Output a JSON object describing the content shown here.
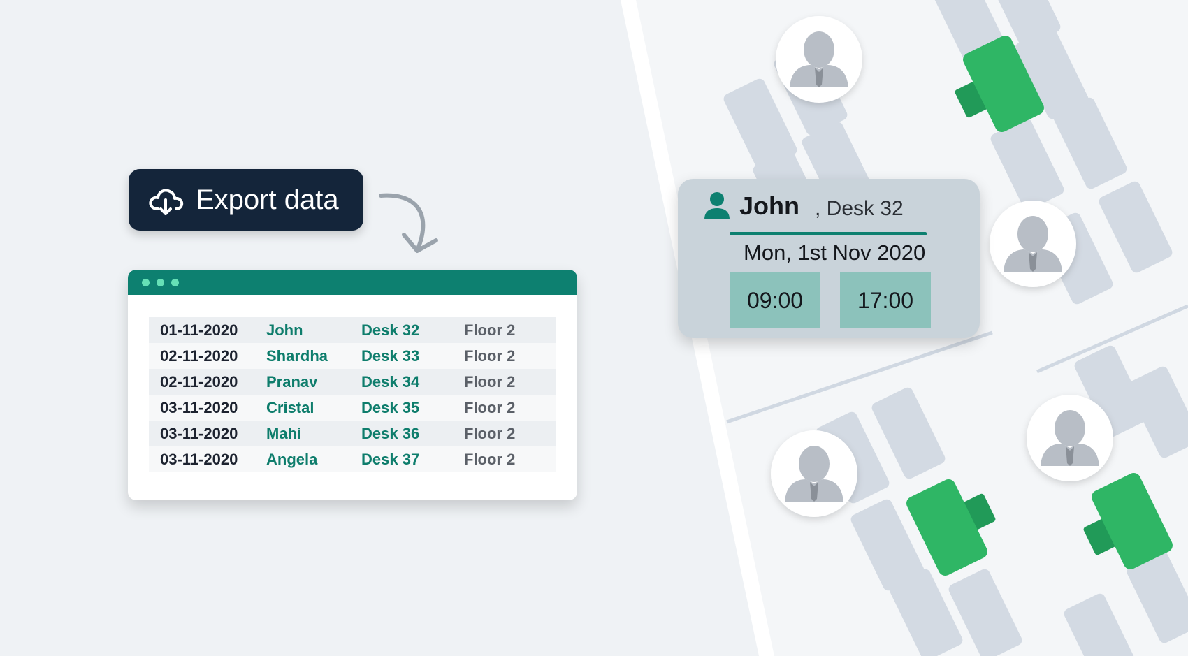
{
  "export_button": {
    "label": "Export data",
    "icon": "cloud-download-icon"
  },
  "sheet": {
    "rows": [
      {
        "date": "01-11-2020",
        "name": "John",
        "desk": "Desk 32",
        "floor": "Floor 2"
      },
      {
        "date": "02-11-2020",
        "name": "Shardha",
        "desk": "Desk 33",
        "floor": "Floor 2"
      },
      {
        "date": "02-11-2020",
        "name": "Pranav",
        "desk": "Desk 34",
        "floor": "Floor 2"
      },
      {
        "date": "03-11-2020",
        "name": "Cristal",
        "desk": "Desk 35",
        "floor": "Floor 2"
      },
      {
        "date": "03-11-2020",
        "name": "Mahi",
        "desk": "Desk 36",
        "floor": "Floor 2"
      },
      {
        "date": "03-11-2020",
        "name": "Angela",
        "desk": "Desk 37",
        "floor": "Floor 2"
      }
    ]
  },
  "booking_popup": {
    "name": "John",
    "desk": ", Desk 32",
    "date": "Mon, 1st Nov 2020",
    "start_time": "09:00",
    "end_time": "17:00"
  },
  "colors": {
    "brand_green": "#0d8070",
    "booked_desk": "#2fb665",
    "button_dark": "#14253a",
    "desk_grey": "#d3dae3"
  }
}
